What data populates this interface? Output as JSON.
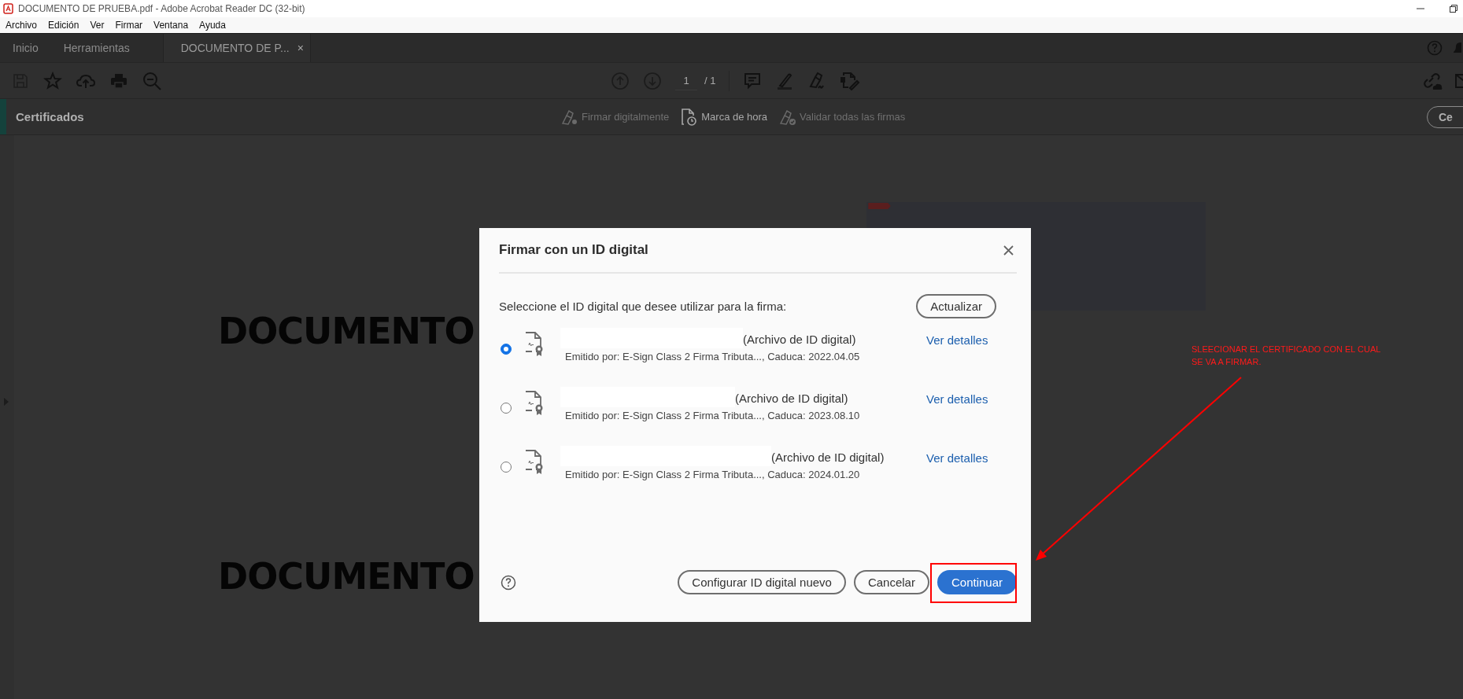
{
  "window": {
    "title": "DOCUMENTO DE PRUEBA.pdf - Adobe Acrobat Reader DC (32-bit)"
  },
  "menu": [
    "Archivo",
    "Edición",
    "Ver",
    "Firmar",
    "Ventana",
    "Ayuda"
  ],
  "tabs": [
    {
      "label": "Inicio",
      "selected": false
    },
    {
      "label": "Herramientas",
      "selected": false
    },
    {
      "label": "DOCUMENTO DE P...",
      "selected": true,
      "close": "×"
    }
  ],
  "toolbar": {
    "page": "1",
    "page_total": "/ 1"
  },
  "panel": {
    "title": "Certificados",
    "actions": [
      {
        "label": "Firmar digitalmente",
        "disabled": true
      },
      {
        "label": "Marca de hora",
        "disabled": false
      },
      {
        "label": "Validar todas las firmas",
        "disabled": true
      }
    ],
    "button": "Ce"
  },
  "document": {
    "headings": [
      "DOCUMENTO",
      "DOCUMENTO"
    ]
  },
  "dialog": {
    "title": "Firmar con un ID digital",
    "prompt": "Seleccione el ID digital que desee utilizar para la firma:",
    "refresh": "Actualizar",
    "ids": [
      {
        "type": "(Archivo de ID digital)",
        "issuer": "Emitido por: E-Sign Class 2 Firma Tributa..., Caduca: 2022.04.05",
        "details": "Ver detalles",
        "selected": true
      },
      {
        "type": "(Archivo de ID digital)",
        "issuer": "Emitido por: E-Sign Class 2 Firma Tributa..., Caduca: 2023.08.10",
        "details": "Ver detalles",
        "selected": false
      },
      {
        "type": "(Archivo de ID digital)",
        "issuer": "Emitido por: E-Sign Class 2 Firma Tributa..., Caduca: 2024.01.20",
        "details": "Ver detalles",
        "selected": false
      }
    ],
    "buttons": [
      {
        "label": "Configurar ID digital nuevo",
        "kind": "secondary"
      },
      {
        "label": "Cancelar",
        "kind": "secondary"
      },
      {
        "label": "Continuar",
        "kind": "primary"
      }
    ]
  },
  "annotation": {
    "lines": [
      "SLEECIONAR EL CERTIFICADO CON EL CUAL",
      "SE VA A FIRMAR."
    ]
  }
}
